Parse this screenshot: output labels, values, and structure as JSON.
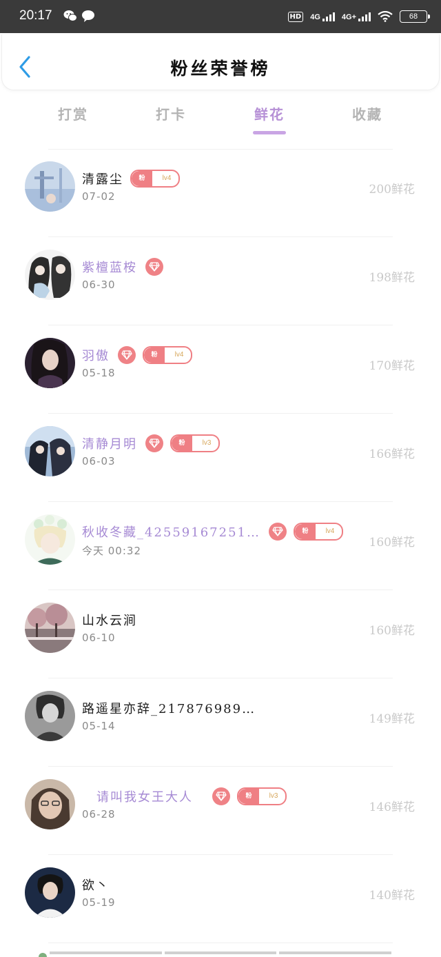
{
  "status_bar": {
    "time": "20:17",
    "hd_label": "HD",
    "hd_sub": "1 2",
    "net1": "4G",
    "net2": "4G+",
    "battery": "68"
  },
  "header": {
    "title": "粉丝荣誉榜"
  },
  "tabs": [
    {
      "label": "打赏",
      "active": false
    },
    {
      "label": "打卡",
      "active": false
    },
    {
      "label": "鲜花",
      "active": true
    },
    {
      "label": "收藏",
      "active": false
    }
  ],
  "colors": {
    "accent_purple": "#b690d6",
    "vip_name": "#a68ad4",
    "badge_red": "#ef7f84",
    "score_gray": "#c9c9c9"
  },
  "fan_badge_text": "粉",
  "fans": [
    {
      "name": "清露尘",
      "date": "07-02",
      "score": "200鲜花",
      "vip": false,
      "diamond": false,
      "level": "lv4"
    },
    {
      "name": "紫檀蓝桉",
      "date": "06-30",
      "score": "198鲜花",
      "vip": true,
      "diamond": true,
      "level": ""
    },
    {
      "name": "羽傲",
      "date": "05-18",
      "score": "170鲜花",
      "vip": true,
      "diamond": true,
      "level": "lv4"
    },
    {
      "name": "清静月明",
      "date": "06-03",
      "score": "166鲜花",
      "vip": true,
      "diamond": true,
      "level": "lv3"
    },
    {
      "name": "秋收冬藏_42559167251…",
      "date": "今天  00:32",
      "score": "160鲜花",
      "vip": true,
      "diamond": true,
      "level": "lv4"
    },
    {
      "name": "山水云涧",
      "date": "06-10",
      "score": "160鲜花",
      "vip": false,
      "diamond": false,
      "level": ""
    },
    {
      "name": "路遥星亦辞_217876989…",
      "date": "05-14",
      "score": "149鲜花",
      "vip": false,
      "diamond": false,
      "level": ""
    },
    {
      "name": "请叫我女王大人",
      "date": "06-28",
      "score": "146鲜花",
      "vip": true,
      "diamond": true,
      "level": "lv3"
    },
    {
      "name": "欲丶",
      "date": "05-19",
      "score": "140鲜花",
      "vip": false,
      "diamond": false,
      "level": ""
    }
  ]
}
